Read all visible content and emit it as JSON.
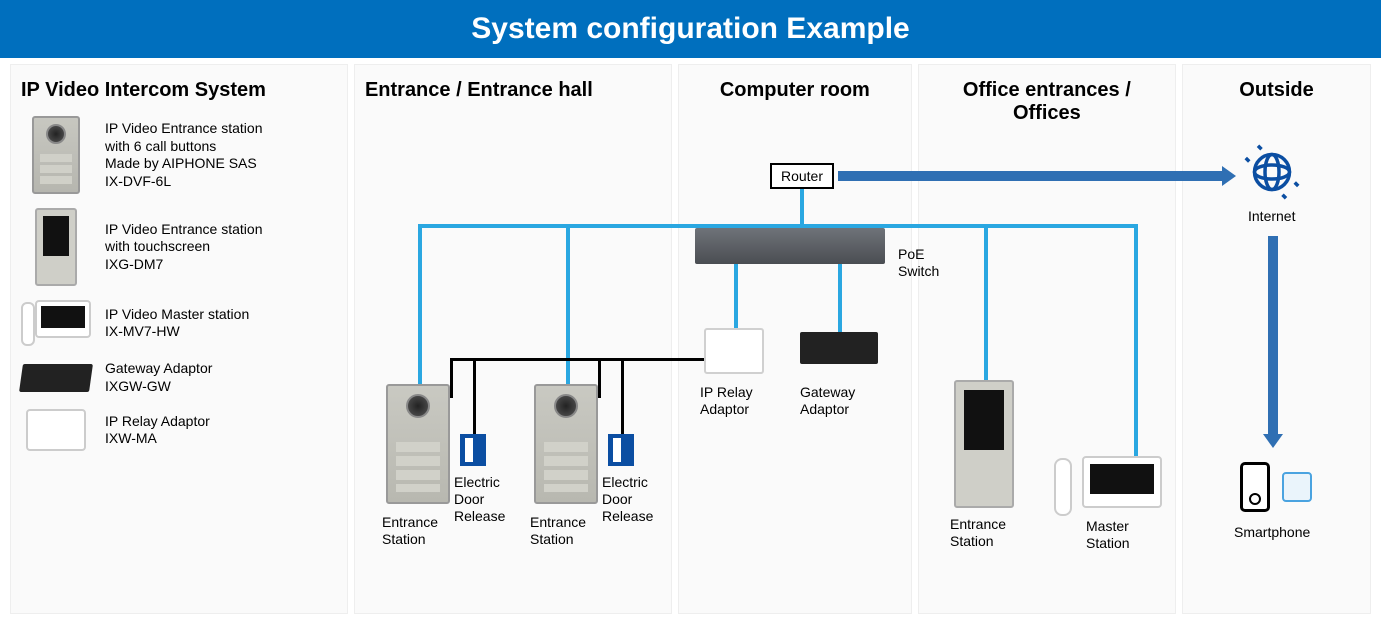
{
  "title": "System configuration Example",
  "columns": {
    "c1": "IP Video Intercom System",
    "c2": "Entrance / Entrance hall",
    "c3": "Computer room",
    "c4": "Office entrances / Offices",
    "c5": "Outside"
  },
  "products": {
    "p1": {
      "line1": "IP Video Entrance station",
      "line2": "with 6 call buttons",
      "line3": "Made by AIPHONE SAS",
      "model": "IX-DVF-6L"
    },
    "p2": {
      "line1": "IP Video Entrance station",
      "line2": "with touchscreen",
      "model": "IXG-DM7"
    },
    "p3": {
      "line1": "IP Video Master station",
      "model": "IX-MV7-HW"
    },
    "p4": {
      "line1": "Gateway Adaptor",
      "model": "IXGW-GW"
    },
    "p5": {
      "line1": "IP Relay Adaptor",
      "model": "IXW-MA"
    }
  },
  "labels": {
    "router": "Router",
    "poe1": "PoE",
    "poe2": "Switch",
    "relay1": "IP Relay",
    "relay2": "Adaptor",
    "gw1": "Gateway",
    "gw2": "Adaptor",
    "entrance1": "Entrance",
    "entrance2": "Station",
    "door1": "Electric",
    "door2": "Door",
    "door3": "Release",
    "master1": "Master",
    "master2": "Station",
    "internet": "Internet",
    "smartphone": "Smartphone"
  }
}
